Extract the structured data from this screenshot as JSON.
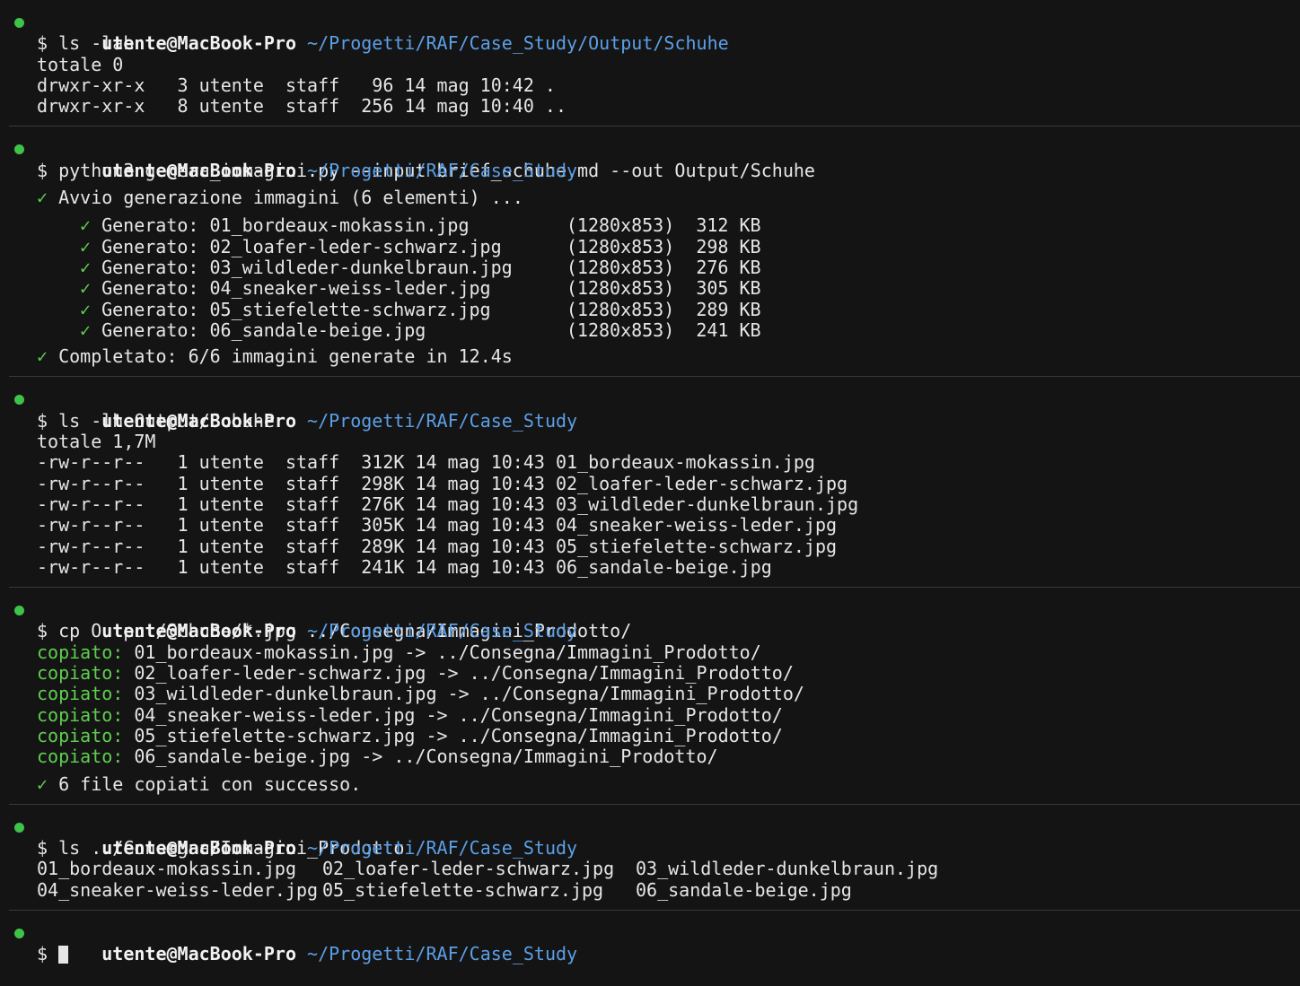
{
  "prompt": {
    "user": "utente@MacBook-Pro",
    "accent": "#3fc24a",
    "path_color": "#5c9fe6"
  },
  "blocks": [
    {
      "path": "~/Progetti/RAF/Case_Study/Output/Schuhe",
      "command": "$ ls -lah",
      "output": [
        "totale 0",
        "drwxr-xr-x   3 utente  staff   96 14 mag 10:42 .",
        "drwxr-xr-x   8 utente  staff  256 14 mag 10:40 .."
      ]
    },
    {
      "path": "~/Progetti/RAF/Case_Study",
      "command": "$ python3 genera_immagini.py --input brief_schuhe.md --out Output/Schuhe",
      "start": "Avvio generazione immagini (6 elementi) ...",
      "generated": [
        {
          "text": "Generato: 01_bordeaux-mokassin.jpg         (1280x853)  312 KB"
        },
        {
          "text": "Generato: 02_loafer-leder-schwarz.jpg      (1280x853)  298 KB"
        },
        {
          "text": "Generato: 03_wildleder-dunkelbraun.jpg     (1280x853)  276 KB"
        },
        {
          "text": "Generato: 04_sneaker-weiss-leder.jpg       (1280x853)  305 KB"
        },
        {
          "text": "Generato: 05_stiefelette-schwarz.jpg       (1280x853)  289 KB"
        },
        {
          "text": "Generato: 06_sandale-beige.jpg             (1280x853)  241 KB"
        }
      ],
      "done": "Completato: 6/6 immagini generate in 12.4s"
    },
    {
      "path": "~/Progetti/RAF/Case_Study",
      "command": "$ ls -lh Output/Schuhe",
      "output": [
        "totale 1,7M",
        "-rw-r--r--   1 utente  staff  312K 14 mag 10:43 01_bordeaux-mokassin.jpg",
        "-rw-r--r--   1 utente  staff  298K 14 mag 10:43 02_loafer-leder-schwarz.jpg",
        "-rw-r--r--   1 utente  staff  276K 14 mag 10:43 03_wildleder-dunkelbraun.jpg",
        "-rw-r--r--   1 utente  staff  305K 14 mag 10:43 04_sneaker-weiss-leder.jpg",
        "-rw-r--r--   1 utente  staff  289K 14 mag 10:43 05_stiefelette-schwarz.jpg",
        "-rw-r--r--   1 utente  staff  241K 14 mag 10:43 06_sandale-beige.jpg"
      ]
    },
    {
      "path": "~/Progetti/RAF/Case_Study",
      "command": "$ cp Output/Schuhe/*.jpg ../Consegna/Immagini_Prodotto/",
      "copied_label": "copiato:",
      "copied": [
        " 01_bordeaux-mokassin.jpg -> ../Consegna/Immagini_Prodotto/",
        " 02_loafer-leder-schwarz.jpg -> ../Consegna/Immagini_Prodotto/",
        " 03_wildleder-dunkelbraun.jpg -> ../Consegna/Immagini_Prodotto/",
        " 04_sneaker-weiss-leder.jpg -> ../Consegna/Immagini_Prodotto/",
        " 05_stiefelette-schwarz.jpg -> ../Consegna/Immagini_Prodotto/",
        " 06_sandale-beige.jpg -> ../Consegna/Immagini_Prodotto/"
      ],
      "done": "6 file copiati con successo."
    },
    {
      "path": "~/Progetti/RAF/Case_Study",
      "command": "$ ls ../Consegna/Immagini_Prodotto",
      "grid": [
        [
          "01_bordeaux-mokassin.jpg",
          "02_loafer-leder-schwarz.jpg",
          "03_wildleder-dunkelbraun.jpg"
        ],
        [
          "04_sneaker-weiss-leder.jpg",
          "05_stiefelette-schwarz.jpg",
          "06_sandale-beige.jpg"
        ]
      ]
    },
    {
      "path": "~/Progetti/RAF/Case_Study",
      "command": "$ "
    }
  ],
  "check_glyph": "✓"
}
